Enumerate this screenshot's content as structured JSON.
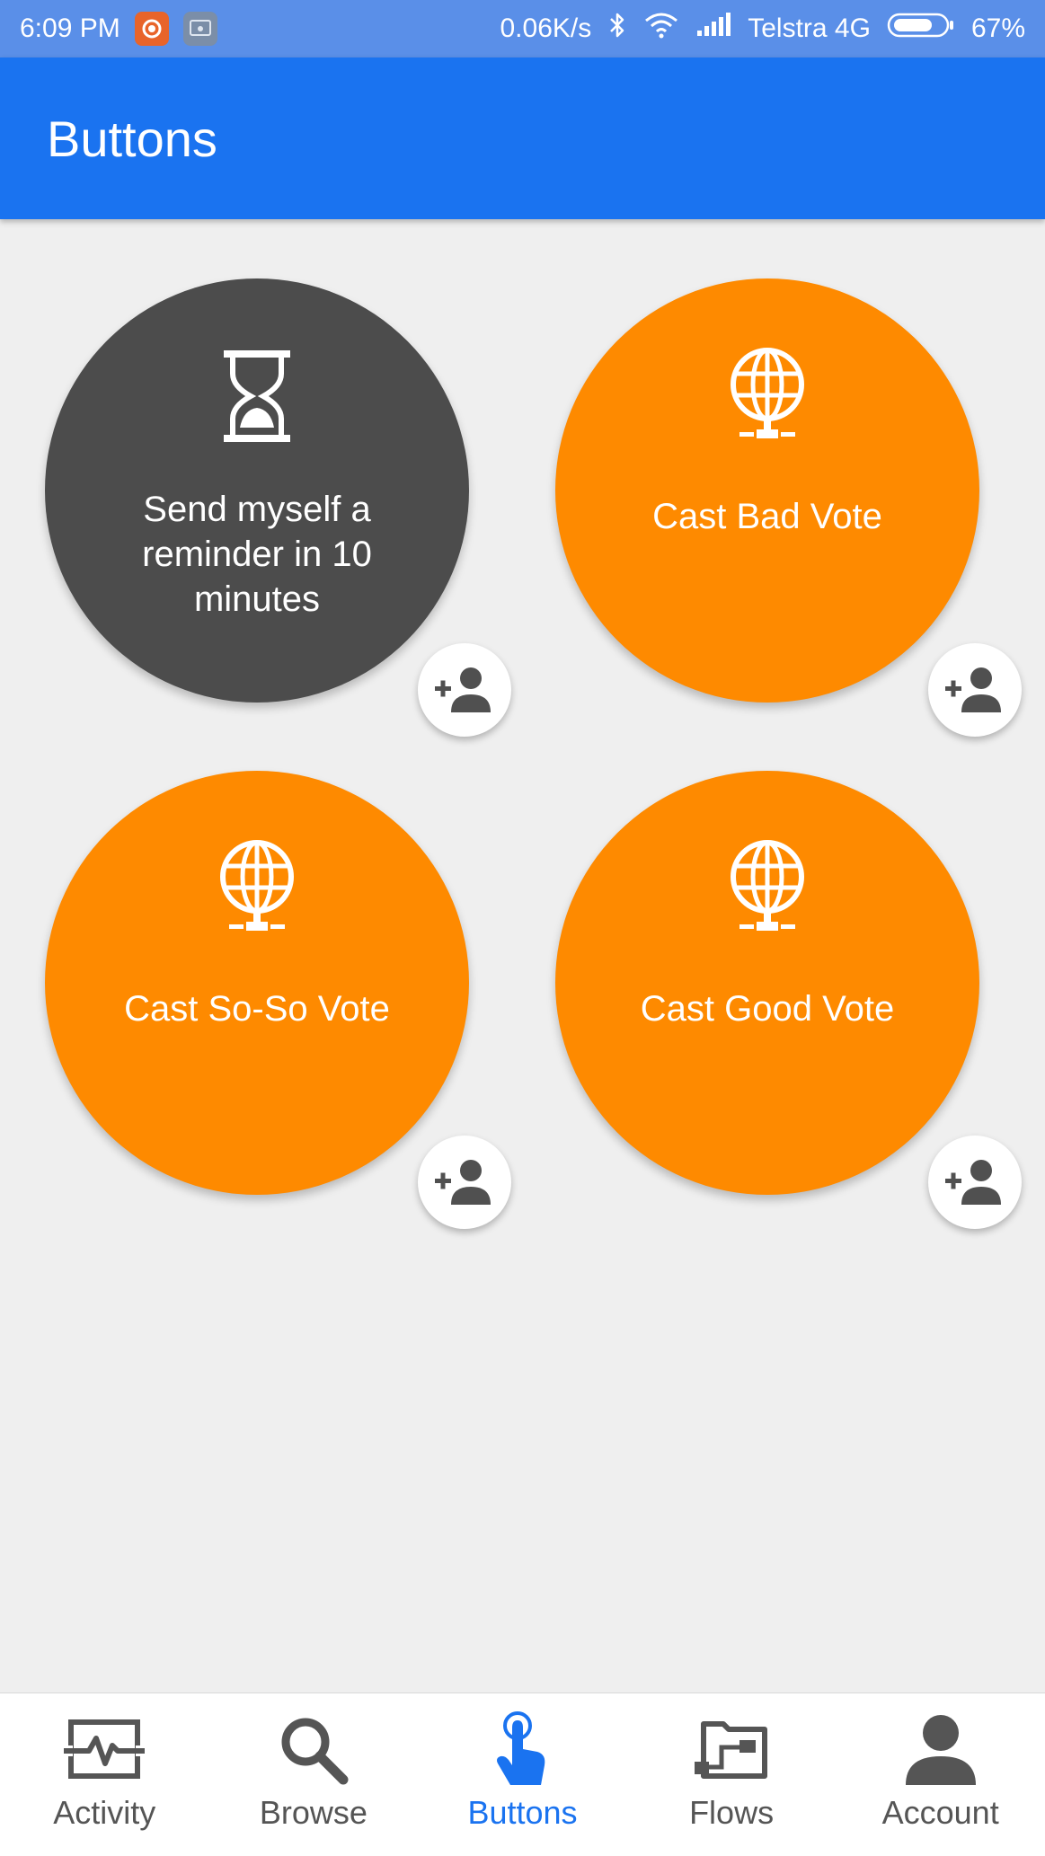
{
  "status_bar": {
    "time": "6:09 PM",
    "network_speed": "0.06K/s",
    "carrier": "Telstra 4G",
    "battery": "67%",
    "icons": [
      "app-notification-icon",
      "screen-cast-icon",
      "bluetooth-icon",
      "wifi-icon",
      "signal-icon",
      "battery-icon"
    ]
  },
  "app_bar": {
    "title": "Buttons"
  },
  "buttons": [
    {
      "label": "Send myself a reminder in 10 minutes",
      "icon": "hourglass-icon",
      "color": "#4c4c4c"
    },
    {
      "label": "Cast Bad Vote",
      "icon": "globe-network-icon",
      "color": "#fe8a00"
    },
    {
      "label": "Cast So-So Vote",
      "icon": "globe-network-icon",
      "color": "#fe8a00"
    },
    {
      "label": "Cast Good Vote",
      "icon": "globe-network-icon",
      "color": "#fe8a00"
    }
  ],
  "add_person_icon": "add-person-icon",
  "bottom_nav": {
    "active": "Buttons",
    "items": [
      {
        "label": "Activity",
        "icon": "activity-icon"
      },
      {
        "label": "Browse",
        "icon": "search-icon"
      },
      {
        "label": "Buttons",
        "icon": "touch-icon"
      },
      {
        "label": "Flows",
        "icon": "flows-icon"
      },
      {
        "label": "Account",
        "icon": "account-icon"
      }
    ]
  },
  "colors": {
    "status_bar": "#5a8fe8",
    "app_bar": "#1a73f0",
    "background": "#efefef",
    "accent_orange": "#fe8a00",
    "dark_button": "#4c4c4c",
    "active_nav": "#1a73f0",
    "inactive_nav": "#555555"
  }
}
